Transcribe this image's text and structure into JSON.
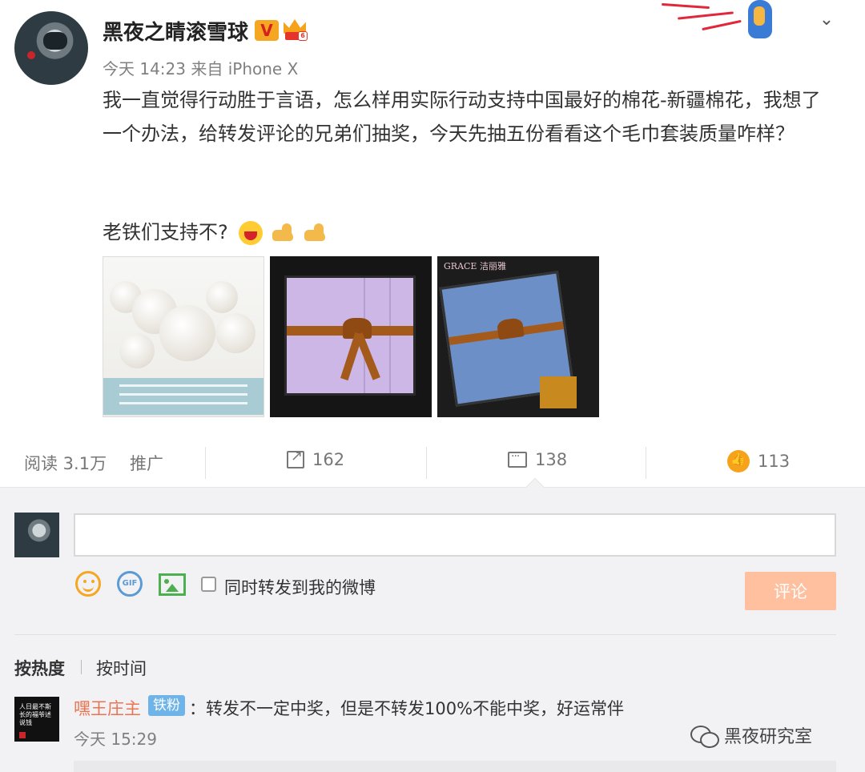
{
  "post": {
    "username": "黑夜之睛滚雪球",
    "verified_badge": "V",
    "vip_level": "6",
    "meta": "今天 14:23 来自 iPhone X",
    "content": "我一直觉得行动胜于言语，怎么样用实际行动支持中国最好的棉花-新疆棉花，我想了一个办法，给转发评论的兄弟们抽奖，今天先抽五份看看这个毛巾套装质量咋样？",
    "content_line2": "老铁们支持不?",
    "image3_logo": "GRACE 洁丽雅"
  },
  "stats": {
    "reads": "阅读 3.1万",
    "promote": "推广",
    "reposts": "162",
    "comments": "138",
    "likes": "113"
  },
  "composer": {
    "input_value": "",
    "sync_label": "同时转发到我的微博",
    "submit_label": "评论",
    "gif_label": "GIF"
  },
  "sort": {
    "hot": "按热度",
    "time": "按时间"
  },
  "comment": {
    "user": "嘿王庄主",
    "badge": "铁粉",
    "text": "：转发不一定中奖，但是不转发100%不能中奖，好运常伴",
    "time": "今天 15:29",
    "avatar_text": "人日最不斯长的福爷述说钱"
  },
  "watermark": "黑夜研究室",
  "colors": {
    "username_link": "#eb7350",
    "submit_button": "#ffc09f",
    "fan_badge": "#6eb4e8"
  }
}
